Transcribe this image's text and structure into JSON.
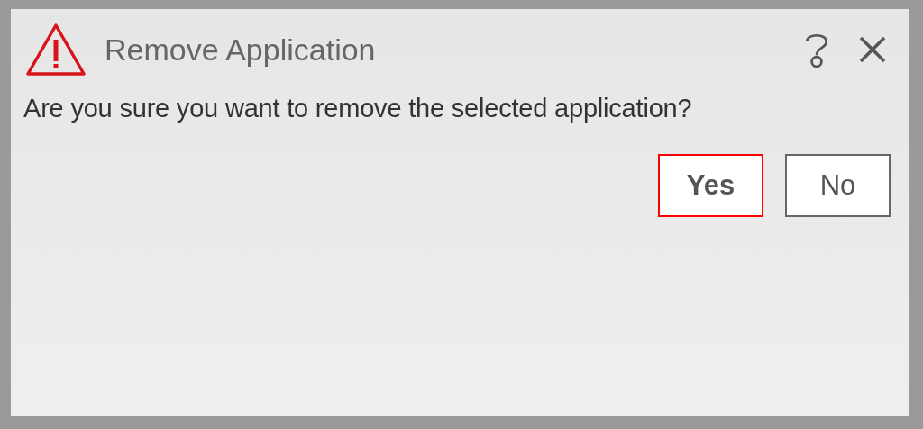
{
  "dialog": {
    "title": "Remove Application",
    "message": "Are you sure you want to remove the selected application?",
    "buttons": [
      {
        "label": "Yes",
        "selected": true
      },
      {
        "label": "No",
        "selected": false
      }
    ]
  }
}
